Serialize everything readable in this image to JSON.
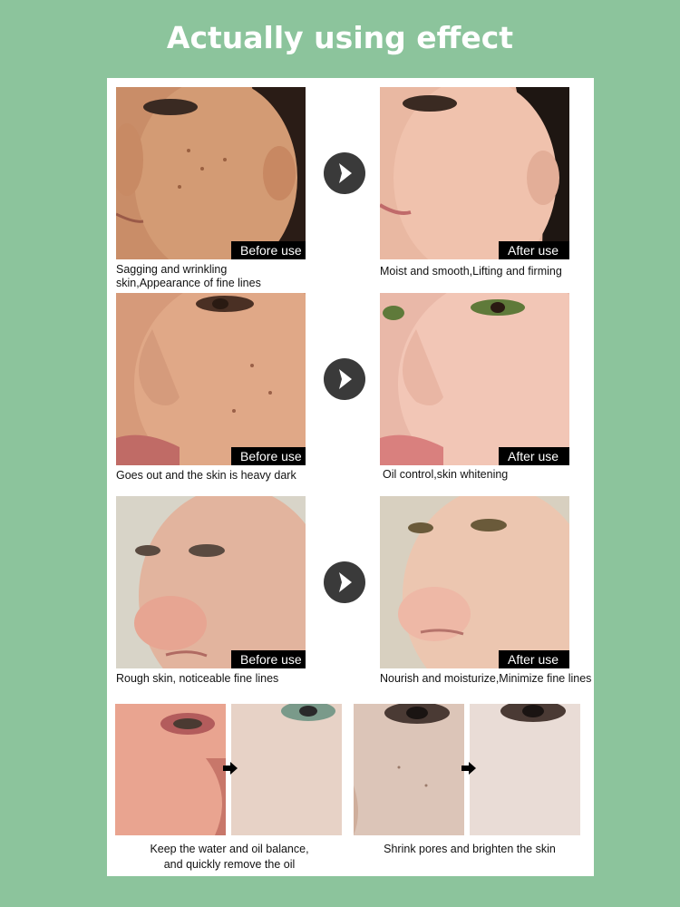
{
  "header": {
    "title": "Actually using effect"
  },
  "rows": [
    {
      "before_label": "Before use",
      "after_label": "After use",
      "before_caption": "Sagging and wrinkling skin,Appearance of fine lines",
      "after_caption": "Moist and smooth,Lifting and firming"
    },
    {
      "before_label": "Before use",
      "after_label": "After use",
      "before_caption": "Goes out and the skin is heavy dark",
      "after_caption": "Oil control,skin whitening"
    },
    {
      "before_label": "Before use",
      "after_label": "After use",
      "before_caption": "Rough skin, noticeable fine lines",
      "after_caption": "Nourish and moisturize,Minimize fine lines"
    }
  ],
  "bottom": {
    "left_caption_line1": "Keep the water and oil balance,",
    "left_caption_line2": "and quickly remove the oil",
    "right_caption": "Shrink pores and brighten the skin"
  },
  "icons": {
    "row_arrow": "chevron-right-icon",
    "small_arrow": "arrow-right-icon"
  },
  "colors": {
    "background": "#8cc49c",
    "panel": "#ffffff",
    "tag": "#000000",
    "arrow_circle": "#3a3a3a"
  }
}
